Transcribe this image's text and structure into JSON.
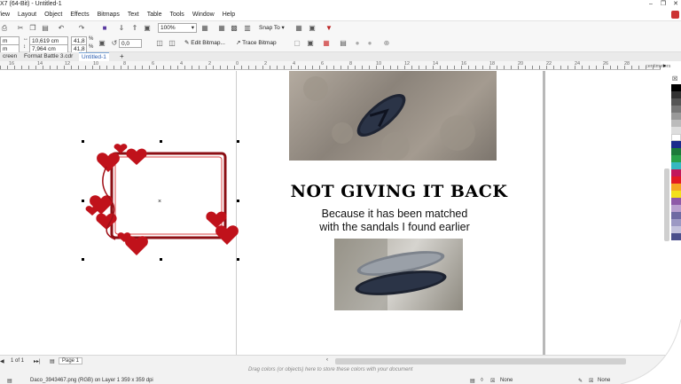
{
  "window": {
    "title": "X7 (64-Bit) - Untitled-1"
  },
  "menu": [
    "View",
    "Layout",
    "Object",
    "Effects",
    "Bitmaps",
    "Text",
    "Table",
    "Tools",
    "Window",
    "Help"
  ],
  "toolbar": {
    "zoom": "100%",
    "snap_to": "Snap To"
  },
  "propbar": {
    "width": "10,619 cm",
    "height": "7,964 cm",
    "scale_x": "41,8",
    "scale_y": "41,8",
    "pct": "%",
    "rotation": "0,0",
    "edit_bitmap": "Edit Bitmap...",
    "trace_bitmap": "Trace Bitmap"
  },
  "tabs": [
    "creen",
    "Format Battle 3.cdr",
    "Untitled-1"
  ],
  "ruler": {
    "ticks": [
      "16",
      "14",
      "12",
      "10",
      "8",
      "6",
      "4",
      "2",
      "0",
      "2",
      "4",
      "6",
      "8",
      "10",
      "12",
      "14",
      "16",
      "18",
      "20",
      "22",
      "24",
      "26",
      "28"
    ],
    "unit": "centimeters"
  },
  "document": {
    "headline": "NOT GIVING IT BACK",
    "subline1": "Because it has been matched",
    "subline2": "with the sandals I found earlier"
  },
  "statusbar": {
    "page_count": "1 of 1",
    "page_tab": "Page 1",
    "drag_hint": "Drag colors (or objects) here to store these colors with your document",
    "object_info": "Daco_3943467.png (RGB) on Layer 1 359 x 359 dpi",
    "fill": "None",
    "outline": "None"
  },
  "colors": {
    "accent": "#2a5db0",
    "heart": "#c0121b",
    "frame": "#8c0f14"
  }
}
